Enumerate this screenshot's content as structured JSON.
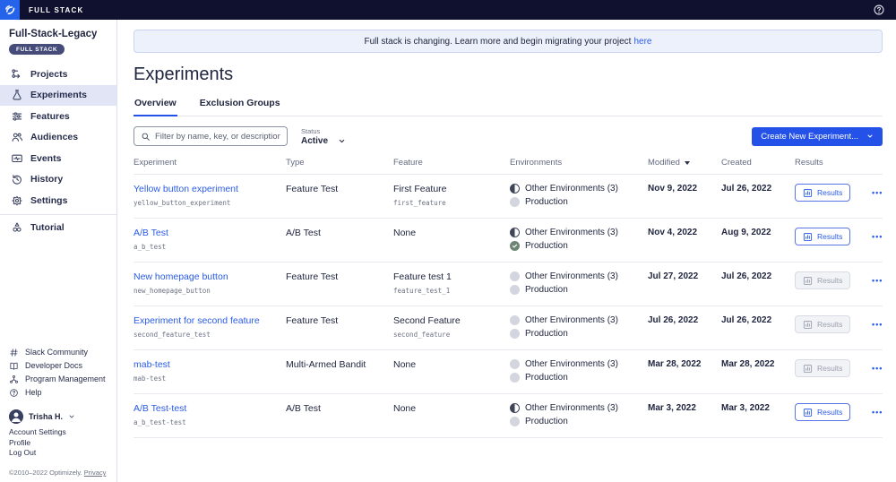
{
  "topbar": {
    "brand": "FULL STACK"
  },
  "sidebar": {
    "project_name": "Full-Stack-Legacy",
    "project_badge": "FULL STACK",
    "nav": [
      {
        "icon": "projects-icon",
        "label": "Projects",
        "active": false
      },
      {
        "icon": "experiments-icon",
        "label": "Experiments",
        "active": true
      },
      {
        "icon": "features-icon",
        "label": "Features",
        "active": false
      },
      {
        "icon": "audiences-icon",
        "label": "Audiences",
        "active": false
      },
      {
        "icon": "events-icon",
        "label": "Events",
        "active": false
      },
      {
        "icon": "history-icon",
        "label": "History",
        "active": false
      },
      {
        "icon": "settings-icon",
        "label": "Settings",
        "active": false
      },
      {
        "icon": "tutorial-icon",
        "label": "Tutorial",
        "active": false,
        "divider_above": true
      }
    ],
    "footer_links": [
      {
        "icon": "hash-icon",
        "label": "Slack Community"
      },
      {
        "icon": "book-icon",
        "label": "Developer Docs"
      },
      {
        "icon": "org-icon",
        "label": "Program Management"
      },
      {
        "icon": "help-icon",
        "label": "Help"
      }
    ],
    "user": {
      "name": "Trisha H.",
      "menu": [
        "Account Settings",
        "Profile",
        "Log Out"
      ]
    },
    "copyright": "©2010–2022 Optimizely.",
    "privacy_link": "Privacy"
  },
  "banner": {
    "text": "Full stack is changing. Learn more and begin migrating your project",
    "link_text": "here"
  },
  "page": {
    "title": "Experiments",
    "tabs": [
      {
        "label": "Overview",
        "active": true
      },
      {
        "label": "Exclusion Groups",
        "active": false
      }
    ]
  },
  "controls": {
    "filter_placeholder": "Filter by name, key, or description",
    "status_label": "Status",
    "status_value": "Active",
    "create_button_label": "Create New Experiment..."
  },
  "table": {
    "headers": [
      "Experiment",
      "Type",
      "Feature",
      "Environments",
      "Modified",
      "Created",
      "Results"
    ],
    "sort_column": "Modified",
    "sort_direction": "descending",
    "results_button_label": "Results",
    "rows": [
      {
        "name": "Yellow button experiment",
        "key": "yellow_button_experiment",
        "type": "Feature Test",
        "feature": "First Feature",
        "feature_key": "first_feature",
        "environments": [
          {
            "status": "partial",
            "label": "Other Environments (3)"
          },
          {
            "status": "off",
            "label": "Production"
          }
        ],
        "modified": "Nov 9, 2022",
        "created": "Jul 26, 2022",
        "results_enabled": true
      },
      {
        "name": "A/B Test",
        "key": "a_b_test",
        "type": "A/B Test",
        "feature": "None",
        "feature_key": "",
        "environments": [
          {
            "status": "partial",
            "label": "Other Environments (3)"
          },
          {
            "status": "running",
            "label": "Production"
          }
        ],
        "modified": "Nov 4, 2022",
        "created": "Aug 9, 2022",
        "results_enabled": true
      },
      {
        "name": "New homepage button",
        "key": "new_homepage_button",
        "type": "Feature Test",
        "feature": "Feature test 1",
        "feature_key": "feature_test_1",
        "environments": [
          {
            "status": "off",
            "label": "Other Environments (3)"
          },
          {
            "status": "off",
            "label": "Production"
          }
        ],
        "modified": "Jul 27, 2022",
        "created": "Jul 26, 2022",
        "results_enabled": false
      },
      {
        "name": "Experiment for second feature",
        "key": "second_feature_test",
        "type": "Feature Test",
        "feature": "Second Feature",
        "feature_key": "second_feature",
        "environments": [
          {
            "status": "off",
            "label": "Other Environments (3)"
          },
          {
            "status": "off",
            "label": "Production"
          }
        ],
        "modified": "Jul 26, 2022",
        "created": "Jul 26, 2022",
        "results_enabled": false
      },
      {
        "name": "mab-test",
        "key": "mab-test",
        "type": "Multi-Armed Bandit",
        "feature": "None",
        "feature_key": "",
        "environments": [
          {
            "status": "off",
            "label": "Other Environments (3)"
          },
          {
            "status": "off",
            "label": "Production"
          }
        ],
        "modified": "Mar 28, 2022",
        "created": "Mar 28, 2022",
        "results_enabled": false
      },
      {
        "name": "A/B Test-test",
        "key": "a_b_test-test",
        "type": "A/B Test",
        "feature": "None",
        "feature_key": "",
        "environments": [
          {
            "status": "partial",
            "label": "Other Environments (3)"
          },
          {
            "status": "off",
            "label": "Production"
          }
        ],
        "modified": "Mar 3, 2022",
        "created": "Mar 3, 2022",
        "results_enabled": true
      }
    ]
  },
  "colors": {
    "topbar_bg": "#10112f",
    "logo_blue": "#2563eb",
    "accent_blue": "#2451e8",
    "link_blue": "#2a5be8",
    "badge_bg": "#454c7a",
    "active_nav_bg": "#e2e5f6",
    "banner_bg": "#edf1fc",
    "banner_border": "#c9d4f3",
    "env_partial": "#3e4558",
    "env_off": "#d3d6de",
    "env_running_green": "#6f8573",
    "disabled_text": "#9aa0b0"
  }
}
